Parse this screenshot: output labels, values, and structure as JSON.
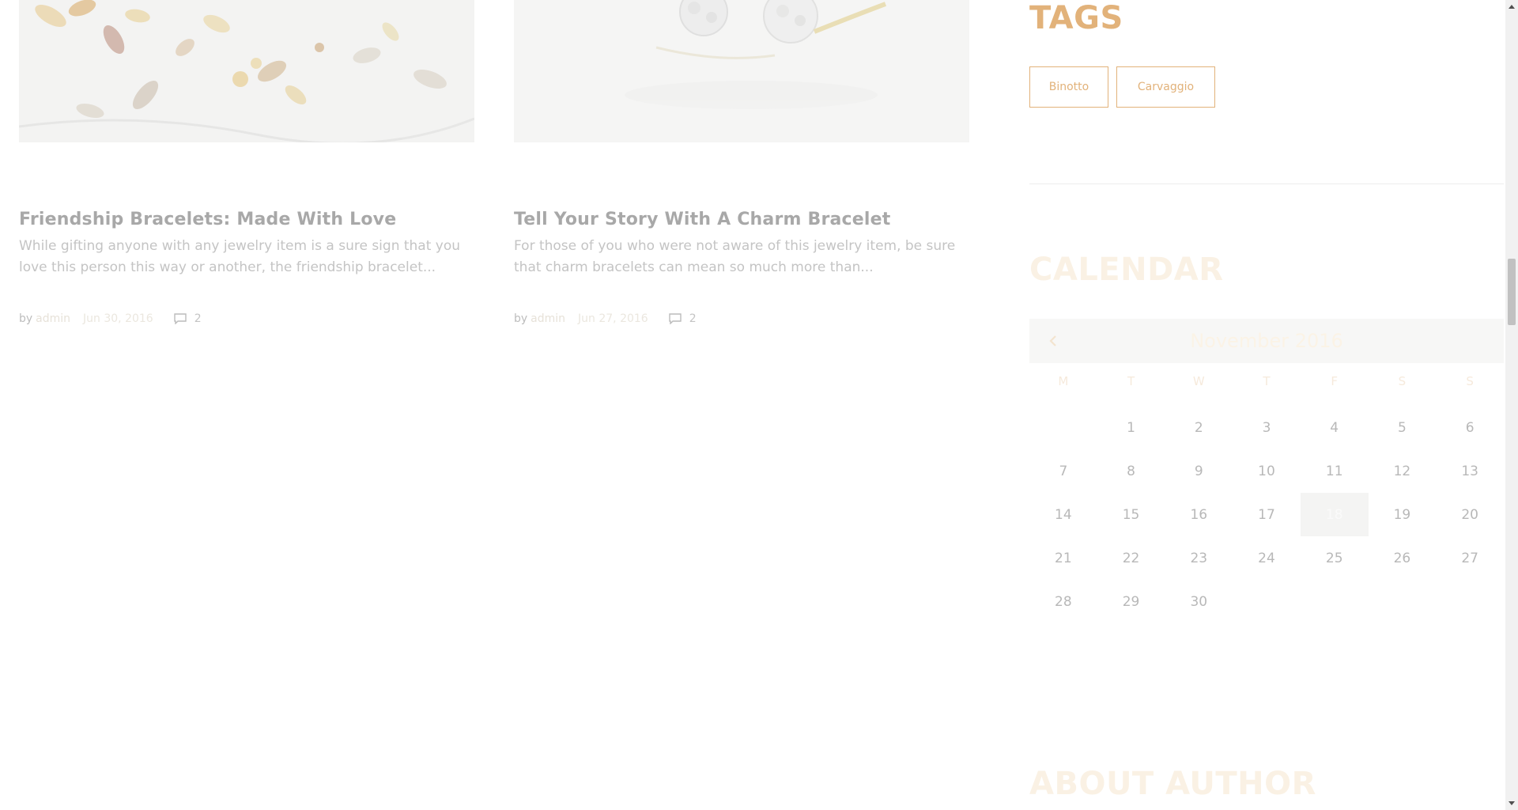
{
  "posts": [
    {
      "title": "Friendship Bracelets: Made With Love",
      "excerpt": "While gifting anyone with any jewelry item is a sure sign that you love this person this way or another, the friendship bracelet...",
      "by": "by",
      "author": "admin",
      "date": "Jun 30, 2016",
      "comments": "2"
    },
    {
      "title": "Tell Your Story With A Charm Bracelet",
      "excerpt": "For those of you who were not aware of this jewelry item, be sure that charm bracelets can mean so much more than...",
      "by": "by",
      "author": "admin",
      "date": "Jun 27, 2016",
      "comments": "2"
    }
  ],
  "sidebar": {
    "tags": {
      "title": "TAGS",
      "items": [
        "Binotto",
        "Carvaggio"
      ]
    },
    "calendar": {
      "title": "CALENDAR",
      "month": "November 2016",
      "prev_icon": "chevron-left-icon",
      "weekdays": [
        "M",
        "T",
        "W",
        "T",
        "F",
        "S",
        "S"
      ],
      "weeks": [
        [
          "",
          "1",
          "2",
          "3",
          "4",
          "5",
          "6"
        ],
        [
          "7",
          "8",
          "9",
          "10",
          "11",
          "12",
          "13"
        ],
        [
          "14",
          "15",
          "16",
          "17",
          "18",
          "19",
          "20"
        ],
        [
          "21",
          "22",
          "23",
          "24",
          "25",
          "26",
          "27"
        ],
        [
          "28",
          "29",
          "30",
          "",
          "",
          "",
          ""
        ]
      ],
      "today": "18"
    },
    "about": {
      "title": "ABOUT AUTHOR"
    }
  },
  "colors": {
    "accent": "#e2b27a",
    "accent_faded": "#faf1e4",
    "text_muted": "#b8b8b8"
  }
}
